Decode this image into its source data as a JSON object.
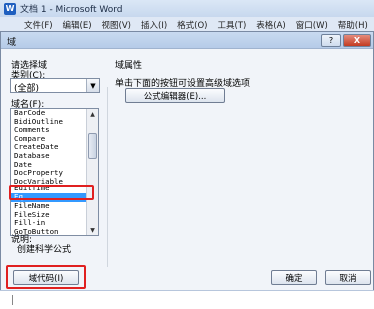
{
  "window": {
    "title": "文档 1 - Microsoft Word",
    "menu": [
      "文件(F)",
      "编辑(E)",
      "视图(V)",
      "插入(I)",
      "格式(O)",
      "工具(T)",
      "表格(A)",
      "窗口(W)",
      "帮助(H)"
    ]
  },
  "dialog": {
    "title": "域",
    "help_label": "?",
    "close_label": "X",
    "choose_field_label": "请选择域",
    "category_label": "类别(C):",
    "category_value": "(全部)",
    "field_names_label": "域名(F):",
    "field_list": [
      "BarCode",
      "BidiOutline",
      "Comments",
      "Compare",
      "CreateDate",
      "Database",
      "Date",
      "DocProperty",
      "DocVariable",
      "EditTime",
      "Eq",
      "FileName",
      "FileSize",
      "Fill-in",
      "GoToButton"
    ],
    "selected_field": "Eq",
    "field_props_label": "域属性",
    "instruction_text": "单击下面的按钮可设置高级域选项",
    "equation_editor_button": "公式编辑器(E)...",
    "description_label": "说明:",
    "description_text": "创建科学公式",
    "field_codes_button": "域代码(I)",
    "ok_button": "确定",
    "cancel_button": "取消"
  }
}
